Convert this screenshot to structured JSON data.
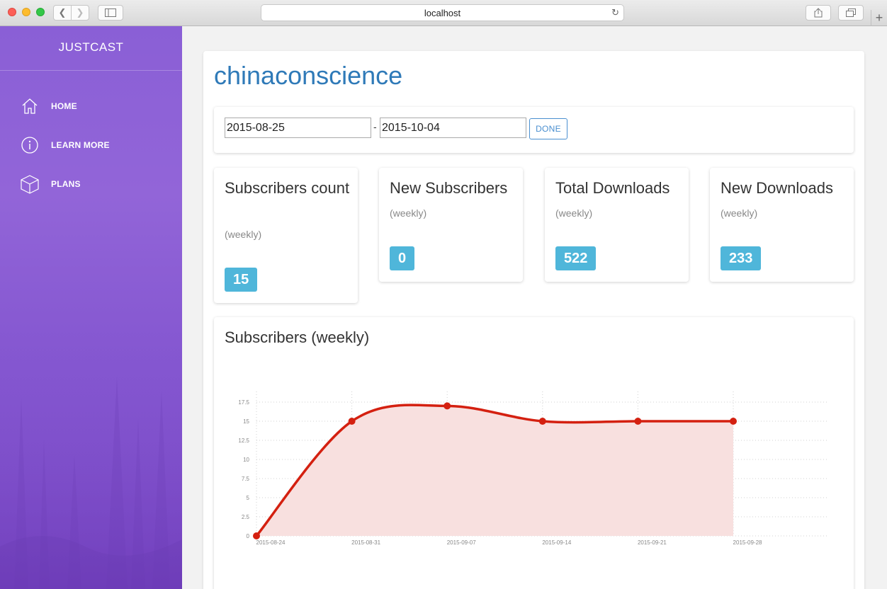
{
  "browser": {
    "url": "localhost"
  },
  "sidebar": {
    "brand": "JUSTCAST",
    "items": [
      {
        "label": "HOME",
        "icon": "home-icon"
      },
      {
        "label": "LEARN MORE",
        "icon": "info-icon"
      },
      {
        "label": "PLANS",
        "icon": "cube-icon"
      }
    ]
  },
  "main": {
    "title": "chinaconscience",
    "date_filter": {
      "from": "2015-08-25",
      "separator": "-",
      "to": "2015-10-04",
      "done_label": "DONE"
    },
    "stats": [
      {
        "title": "Subscribers count",
        "sub": "(weekly)",
        "value": "15"
      },
      {
        "title": "New Subscribers",
        "sub": "(weekly)",
        "value": "0"
      },
      {
        "title": "Total Downloads",
        "sub": "(weekly)",
        "value": "522"
      },
      {
        "title": "New Downloads",
        "sub": "(weekly)",
        "value": "233"
      }
    ]
  },
  "chart_data": {
    "type": "area",
    "title": "Subscribers (weekly)",
    "x": [
      "2015-08-24",
      "2015-08-31",
      "2015-09-07",
      "2015-09-14",
      "2015-09-21",
      "2015-09-28"
    ],
    "series": [
      {
        "values": [
          0,
          15,
          17,
          15,
          15,
          15
        ]
      }
    ],
    "y_ticks": [
      "0",
      "2.5",
      "5",
      "7.5",
      "10",
      "12.5",
      "15",
      "17.5"
    ],
    "ylim": [
      0,
      17.5
    ],
    "grid": true,
    "colors": {
      "line": "#d42010",
      "fill": "#f8e0df",
      "grid": "#d0d0d0"
    }
  }
}
